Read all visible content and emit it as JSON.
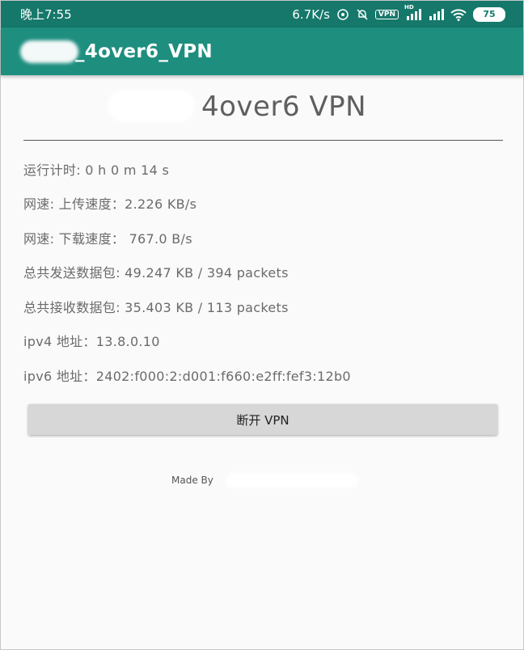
{
  "status_bar": {
    "time": "晚上7:55",
    "net_speed": "6.7K/s",
    "vpn_badge": "VPN",
    "hd_label": "HD",
    "battery": "75",
    "icons": [
      "hotspot-icon",
      "mute-bell-icon",
      "vpn-icon",
      "signal-icon",
      "signal-icon",
      "wifi-icon",
      "battery-icon"
    ]
  },
  "app_bar": {
    "title": "_4over6_VPN"
  },
  "main": {
    "heading": "4over6 VPN",
    "stats": [
      "运行计时: 0 h 0 m 14 s",
      "网速: 上传速度：2.226 KB/s",
      "网速: 下载速度： 767.0 B/s",
      "总共发送数据包: 49.247 KB / 394 packets",
      "总共接收数据包: 35.403 KB / 113 packets",
      "ipv4 地址：13.8.0.10",
      "ipv6 地址：2402:f000:2:d001:f660:e2ff:fef3:12b0"
    ],
    "disconnect_label": "断开 VPN",
    "footer": "Made By"
  },
  "colors": {
    "status_bar": "#15786a",
    "app_bar": "#1e8e7f",
    "background": "#fafafa",
    "button": "#d7d7d7"
  }
}
